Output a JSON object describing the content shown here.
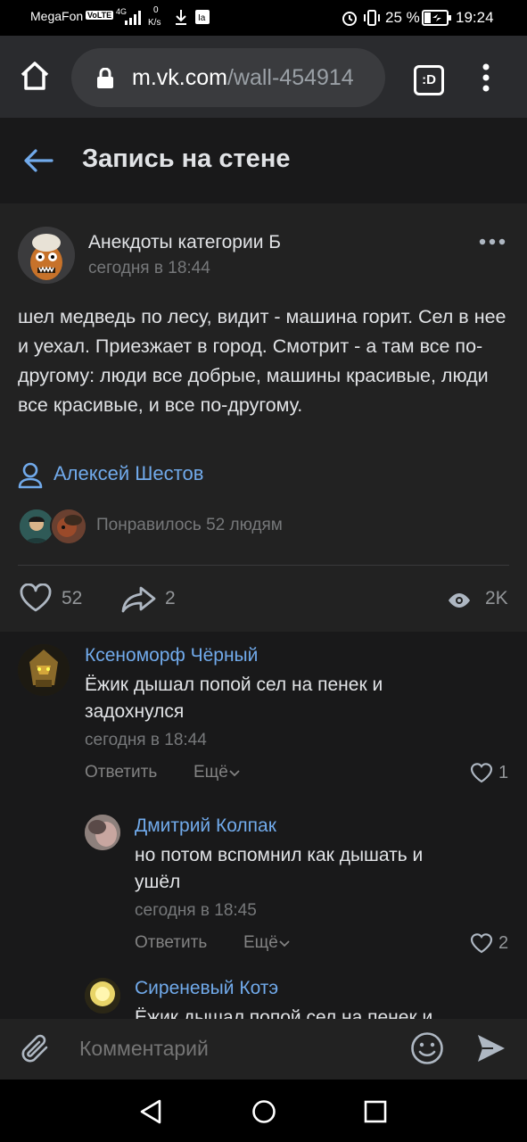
{
  "status_bar": {
    "carrier": "MegaFon",
    "volte": "VoLTE",
    "network": "4G",
    "speed_value": "0",
    "speed_unit": "K/s",
    "battery": "25 %",
    "time": "19:24"
  },
  "browser": {
    "url_host": "m.vk.com",
    "url_path": "/wall-454914",
    "tab_count": ":D"
  },
  "header": {
    "title": "Запись на стене"
  },
  "post": {
    "group_name": "Анекдоты категории Б",
    "timestamp": "сегодня в 18:44",
    "text": "шел медведь по лесу, видит - машина горит. Сел в нее и уехал. Приезжает в город. Смотрит - а там все по-другому: люди все добрые, машины красивые, люди все красивые, и все по-другому.",
    "author": "Алексей Шестов",
    "liked_by": "Понравилось 52 людям",
    "likes": "52",
    "shares": "2",
    "views": "2K"
  },
  "comments": [
    {
      "name": "Ксеноморф Чёрный",
      "text": "Ёжик дышал попой сел на пенек и задохнулся",
      "time": "сегодня в 18:44",
      "reply": "Ответить",
      "more": "Ещё",
      "likes": "1"
    },
    {
      "name": "Дмитрий Колпак",
      "text": "но потом вспомнил как дышать и ушёл",
      "time": "сегодня в 18:45",
      "reply": "Ответить",
      "more": "Ещё",
      "likes": "2"
    },
    {
      "name": "Сиреневый Котэ",
      "text": "Ёжик дышал попой сел на пенек и"
    }
  ],
  "composer": {
    "placeholder": "Комментарий"
  },
  "colors": {
    "accent": "#71aaeb",
    "background": "#19191a",
    "card": "#222222"
  }
}
